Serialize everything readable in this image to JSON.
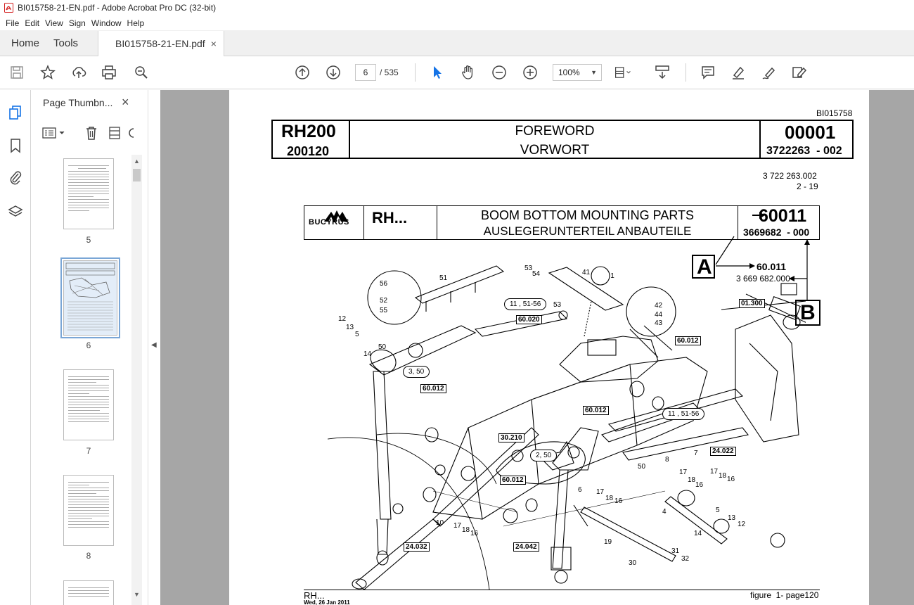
{
  "window": {
    "title": "BI015758-21-EN.pdf - Adobe Acrobat Pro DC (32-bit)"
  },
  "menu": [
    "File",
    "Edit",
    "View",
    "Sign",
    "Window",
    "Help"
  ],
  "tabs": {
    "home": "Home",
    "tools": "Tools",
    "document": "BI015758-21-EN.pdf",
    "close": "×"
  },
  "toolbar": {
    "current_page": "6",
    "total_pages": "/ 535",
    "zoom": "100%"
  },
  "icons": {
    "save": "save-icon",
    "bookmark": "star-icon",
    "share": "upload-icon",
    "print": "printer-icon",
    "find": "search-icon",
    "prev_page": "arrow-up-icon",
    "next_page": "arrow-down-icon",
    "select": "cursor-icon",
    "hand": "hand-icon",
    "zoom_out": "zoom-out-icon",
    "zoom_in": "zoom-in-icon"
  },
  "thumbnail_panel": {
    "title": "Page Thumbn...",
    "close": "×",
    "pages": [
      {
        "number": "5",
        "selected": false
      },
      {
        "number": "6",
        "selected": true
      },
      {
        "number": "7",
        "selected": false
      },
      {
        "number": "8",
        "selected": false
      }
    ]
  },
  "document": {
    "doc_id": "BI015758",
    "header": {
      "model": "RH200",
      "date_code": "200120",
      "title_en": "FOREWORD",
      "title_de": "VORWORT",
      "number": "00001",
      "ref": "3722263  - 002"
    },
    "sub_ref_1": "3 722 263.002",
    "sub_ref_2": "2 - 19",
    "inner_header": {
      "brand": "BUCYRUS",
      "model": "RH...",
      "title_en": "BOOM BOTTOM MOUNTING PARTS",
      "title_de": "AUSLEGERUNTERTEIL ANBAUTEILE",
      "number": "60011",
      "ref": "3669682  - 000"
    },
    "callout_a": {
      "letter": "A",
      "value": "60.011",
      "sub": "3 669 682.000"
    },
    "callout_b": {
      "letter": "B"
    },
    "labels": {
      "l_01300": "01.300",
      "l_60020": "60.020",
      "l_60012a": "60.012",
      "l_60012b": "60.012",
      "l_60012c": "60.012",
      "l_60012d": "60.012",
      "l_30210": "30.210",
      "l_24022": "24.022",
      "l_24032": "24.032",
      "l_24042": "24.042",
      "c_11_51_56a": "11 , 51-56",
      "c_11_51_56b": "11 , 51-56",
      "c_3_50": "3, 50",
      "c_2_50": "2, 50",
      "c_1": "1"
    },
    "part_numbers": [
      "56",
      "52",
      "55",
      "51",
      "53",
      "54",
      "53",
      "41",
      "42",
      "44",
      "43",
      "12",
      "13",
      "5",
      "50",
      "14",
      "8",
      "17",
      "18",
      "16",
      "7",
      "17",
      "18",
      "16",
      "50",
      "6",
      "17",
      "18",
      "16",
      "4",
      "5",
      "13",
      "12",
      "14",
      "10",
      "17",
      "18",
      "16",
      "19",
      "30",
      "31",
      "32"
    ],
    "footer_model": "RH...",
    "footer_date": "Wed, 26 Jan 2011",
    "footer_figure": "figure  1- page120"
  }
}
